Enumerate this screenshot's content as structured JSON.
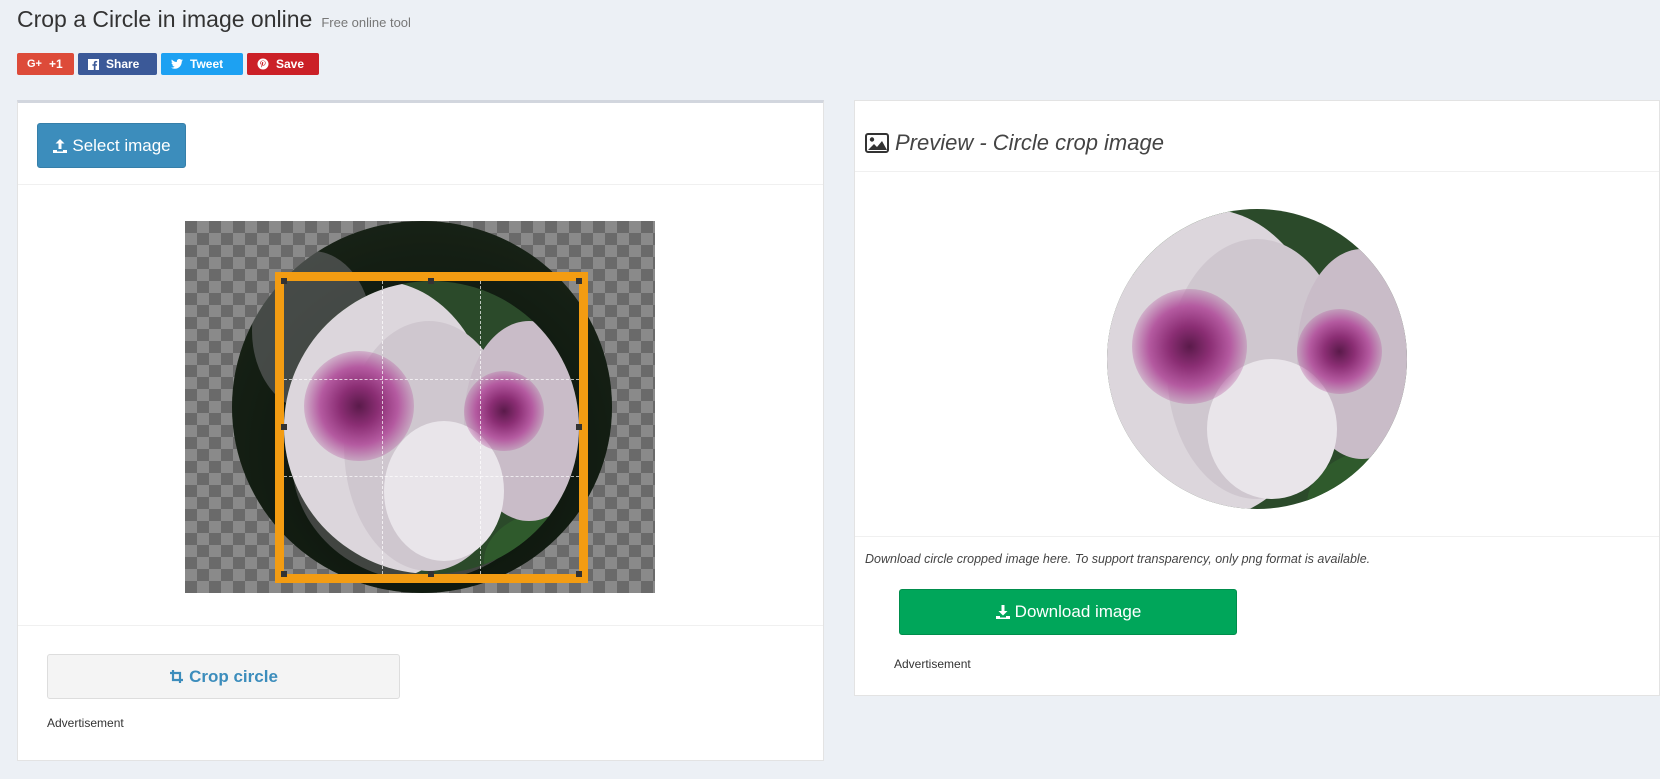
{
  "header": {
    "title": "Crop a Circle in image online",
    "subtitle": "Free online tool"
  },
  "social": {
    "gplus": {
      "icon": "G+",
      "label": "+1",
      "color": "#dd4b39"
    },
    "facebook": {
      "icon": "f",
      "label": "Share",
      "color": "#3b5998"
    },
    "twitter": {
      "icon": "twitter-icon",
      "label": "Tweet",
      "color": "#1da1f2"
    },
    "pinterest": {
      "icon": "pinterest-icon",
      "label": "Save",
      "color": "#cb2027"
    }
  },
  "editor": {
    "select_label": "Select image",
    "crop_label": "Crop circle",
    "ad_label": "Advertisement",
    "accent": "#f39c12",
    "primary": "#3c8dbc"
  },
  "preview": {
    "title": "Preview - Circle crop image",
    "note": "Download circle cropped image here. To support transparency, only png format is available.",
    "download_label": "Download image",
    "ad_label": "Advertisement",
    "download_color": "#00a65a"
  }
}
